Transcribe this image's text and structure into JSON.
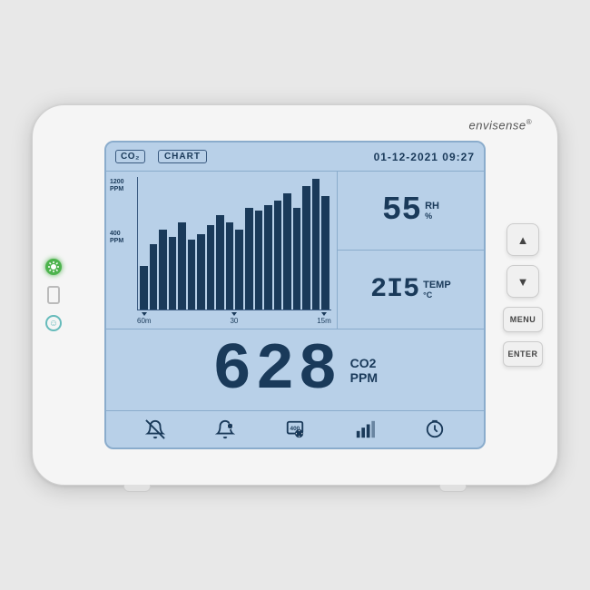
{
  "brand": {
    "name": "envisense",
    "trademark": "®"
  },
  "screen": {
    "topbar": {
      "co2_label": "CO₂",
      "chart_label": "CHART",
      "datetime": "01-12-2021  09:27"
    },
    "chart": {
      "y_labels": [
        "1200\nPPM",
        "400\nPPM"
      ],
      "y_top": "1200",
      "y_top_unit": "PPM",
      "y_bottom": "400",
      "y_bottom_unit": "PPM",
      "x_labels": [
        "60m",
        "30",
        "15m"
      ],
      "bars": [
        30,
        45,
        55,
        50,
        60,
        48,
        52,
        58,
        65,
        60,
        55,
        70,
        68,
        72,
        75,
        80,
        70,
        85,
        90,
        78
      ]
    },
    "humidity": {
      "value": "55",
      "unit": "RH",
      "symbol": "%"
    },
    "temperature": {
      "value": "21.5",
      "display": "2I5",
      "unit": "TEMP",
      "symbol": "°C"
    },
    "co2": {
      "value": "628",
      "label": "CO2",
      "unit": "PPM"
    },
    "bottom_icons": [
      {
        "name": "alarm-off-icon",
        "label": "alarm-off"
      },
      {
        "name": "alarm-settings-icon",
        "label": "alarm-settings"
      },
      {
        "name": "calibration-icon",
        "label": "calibration"
      },
      {
        "name": "chart-icon",
        "label": "chart"
      },
      {
        "name": "timer-icon",
        "label": "timer"
      }
    ]
  },
  "buttons": {
    "up_label": "▲",
    "down_label": "▼",
    "menu_label": "MENU",
    "enter_label": "ENTER"
  },
  "indicators": {
    "sun_color": "#4db34d",
    "smiley": "☺"
  }
}
